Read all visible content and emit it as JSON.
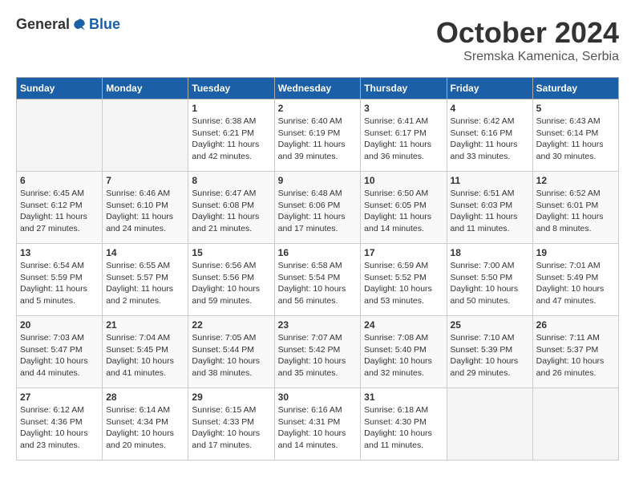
{
  "logo": {
    "general": "General",
    "blue": "Blue"
  },
  "title": "October 2024",
  "subtitle": "Sremska Kamenica, Serbia",
  "days_of_week": [
    "Sunday",
    "Monday",
    "Tuesday",
    "Wednesday",
    "Thursday",
    "Friday",
    "Saturday"
  ],
  "weeks": [
    [
      {
        "day": "",
        "info": ""
      },
      {
        "day": "",
        "info": ""
      },
      {
        "day": "1",
        "info": "Sunrise: 6:38 AM\nSunset: 6:21 PM\nDaylight: 11 hours and 42 minutes."
      },
      {
        "day": "2",
        "info": "Sunrise: 6:40 AM\nSunset: 6:19 PM\nDaylight: 11 hours and 39 minutes."
      },
      {
        "day": "3",
        "info": "Sunrise: 6:41 AM\nSunset: 6:17 PM\nDaylight: 11 hours and 36 minutes."
      },
      {
        "day": "4",
        "info": "Sunrise: 6:42 AM\nSunset: 6:16 PM\nDaylight: 11 hours and 33 minutes."
      },
      {
        "day": "5",
        "info": "Sunrise: 6:43 AM\nSunset: 6:14 PM\nDaylight: 11 hours and 30 minutes."
      }
    ],
    [
      {
        "day": "6",
        "info": "Sunrise: 6:45 AM\nSunset: 6:12 PM\nDaylight: 11 hours and 27 minutes."
      },
      {
        "day": "7",
        "info": "Sunrise: 6:46 AM\nSunset: 6:10 PM\nDaylight: 11 hours and 24 minutes."
      },
      {
        "day": "8",
        "info": "Sunrise: 6:47 AM\nSunset: 6:08 PM\nDaylight: 11 hours and 21 minutes."
      },
      {
        "day": "9",
        "info": "Sunrise: 6:48 AM\nSunset: 6:06 PM\nDaylight: 11 hours and 17 minutes."
      },
      {
        "day": "10",
        "info": "Sunrise: 6:50 AM\nSunset: 6:05 PM\nDaylight: 11 hours and 14 minutes."
      },
      {
        "day": "11",
        "info": "Sunrise: 6:51 AM\nSunset: 6:03 PM\nDaylight: 11 hours and 11 minutes."
      },
      {
        "day": "12",
        "info": "Sunrise: 6:52 AM\nSunset: 6:01 PM\nDaylight: 11 hours and 8 minutes."
      }
    ],
    [
      {
        "day": "13",
        "info": "Sunrise: 6:54 AM\nSunset: 5:59 PM\nDaylight: 11 hours and 5 minutes."
      },
      {
        "day": "14",
        "info": "Sunrise: 6:55 AM\nSunset: 5:57 PM\nDaylight: 11 hours and 2 minutes."
      },
      {
        "day": "15",
        "info": "Sunrise: 6:56 AM\nSunset: 5:56 PM\nDaylight: 10 hours and 59 minutes."
      },
      {
        "day": "16",
        "info": "Sunrise: 6:58 AM\nSunset: 5:54 PM\nDaylight: 10 hours and 56 minutes."
      },
      {
        "day": "17",
        "info": "Sunrise: 6:59 AM\nSunset: 5:52 PM\nDaylight: 10 hours and 53 minutes."
      },
      {
        "day": "18",
        "info": "Sunrise: 7:00 AM\nSunset: 5:50 PM\nDaylight: 10 hours and 50 minutes."
      },
      {
        "day": "19",
        "info": "Sunrise: 7:01 AM\nSunset: 5:49 PM\nDaylight: 10 hours and 47 minutes."
      }
    ],
    [
      {
        "day": "20",
        "info": "Sunrise: 7:03 AM\nSunset: 5:47 PM\nDaylight: 10 hours and 44 minutes."
      },
      {
        "day": "21",
        "info": "Sunrise: 7:04 AM\nSunset: 5:45 PM\nDaylight: 10 hours and 41 minutes."
      },
      {
        "day": "22",
        "info": "Sunrise: 7:05 AM\nSunset: 5:44 PM\nDaylight: 10 hours and 38 minutes."
      },
      {
        "day": "23",
        "info": "Sunrise: 7:07 AM\nSunset: 5:42 PM\nDaylight: 10 hours and 35 minutes."
      },
      {
        "day": "24",
        "info": "Sunrise: 7:08 AM\nSunset: 5:40 PM\nDaylight: 10 hours and 32 minutes."
      },
      {
        "day": "25",
        "info": "Sunrise: 7:10 AM\nSunset: 5:39 PM\nDaylight: 10 hours and 29 minutes."
      },
      {
        "day": "26",
        "info": "Sunrise: 7:11 AM\nSunset: 5:37 PM\nDaylight: 10 hours and 26 minutes."
      }
    ],
    [
      {
        "day": "27",
        "info": "Sunrise: 6:12 AM\nSunset: 4:36 PM\nDaylight: 10 hours and 23 minutes."
      },
      {
        "day": "28",
        "info": "Sunrise: 6:14 AM\nSunset: 4:34 PM\nDaylight: 10 hours and 20 minutes."
      },
      {
        "day": "29",
        "info": "Sunrise: 6:15 AM\nSunset: 4:33 PM\nDaylight: 10 hours and 17 minutes."
      },
      {
        "day": "30",
        "info": "Sunrise: 6:16 AM\nSunset: 4:31 PM\nDaylight: 10 hours and 14 minutes."
      },
      {
        "day": "31",
        "info": "Sunrise: 6:18 AM\nSunset: 4:30 PM\nDaylight: 10 hours and 11 minutes."
      },
      {
        "day": "",
        "info": ""
      },
      {
        "day": "",
        "info": ""
      }
    ]
  ]
}
